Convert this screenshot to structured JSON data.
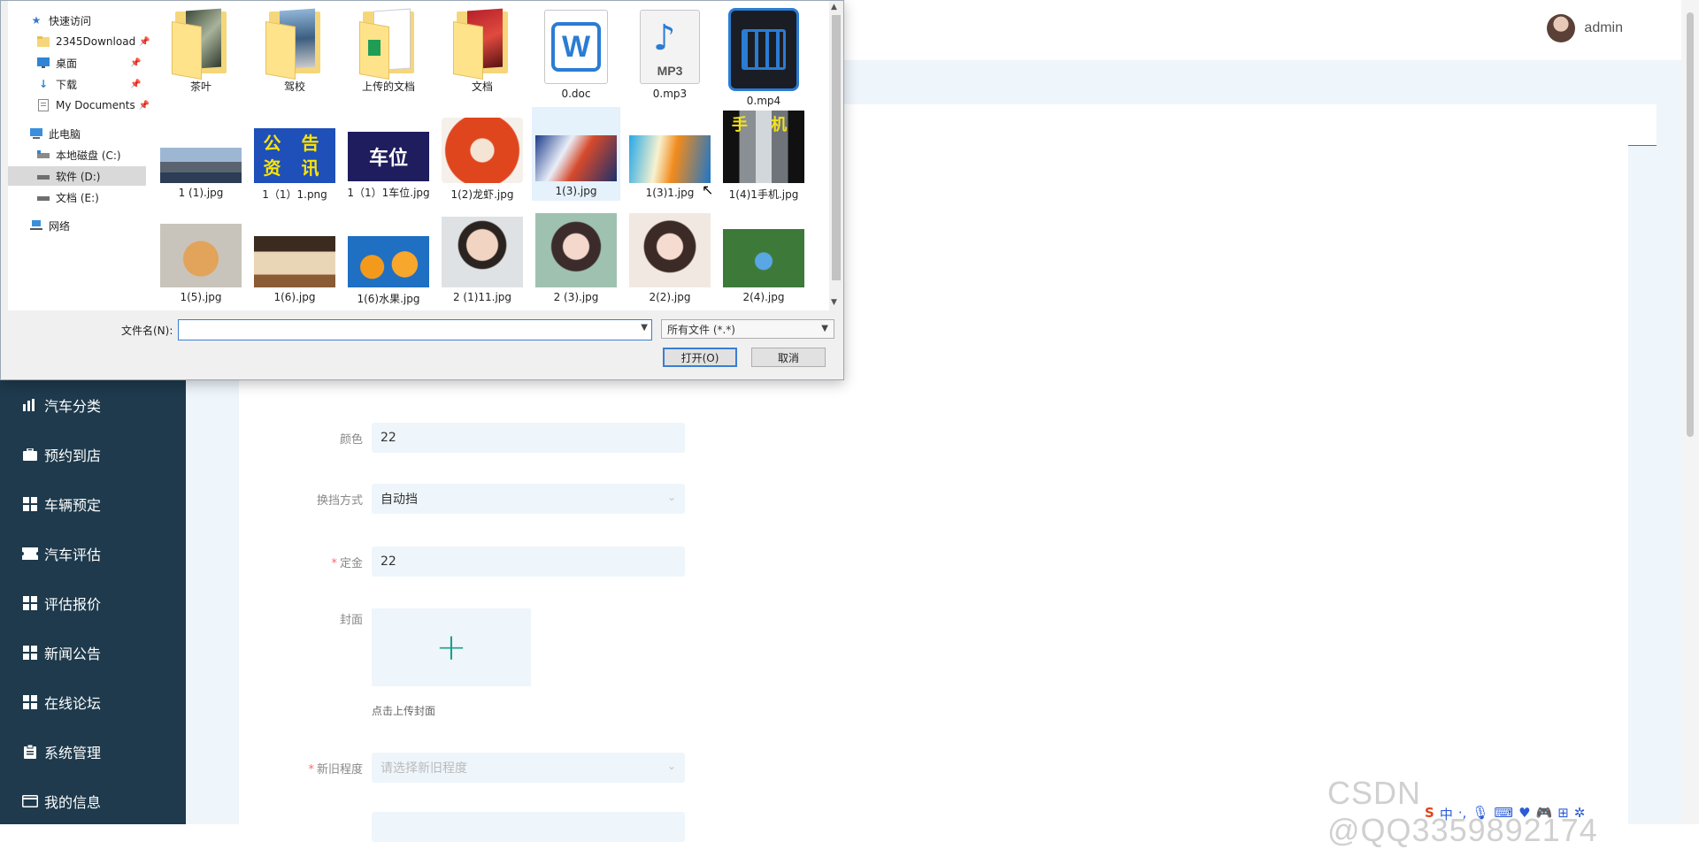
{
  "user": {
    "name": "admin"
  },
  "sidebar": {
    "items": [
      {
        "label": "汽车分类",
        "icon": "bar-chart-icon"
      },
      {
        "label": "预约到店",
        "icon": "briefcase-icon"
      },
      {
        "label": "车辆预定",
        "icon": "grid-icon"
      },
      {
        "label": "汽车评估",
        "icon": "ticket-icon"
      },
      {
        "label": "评估报价",
        "icon": "grid-icon"
      },
      {
        "label": "新闻公告",
        "icon": "grid-icon"
      },
      {
        "label": "在线论坛",
        "icon": "grid-icon"
      },
      {
        "label": "系统管理",
        "icon": "clipboard-icon"
      },
      {
        "label": "我的信息",
        "icon": "id-card-icon"
      }
    ]
  },
  "form": {
    "color_label": "颜色",
    "color_value": "22",
    "gear_label": "换挡方式",
    "gear_value": "自动挡",
    "deposit_label": "定金",
    "deposit_value": "22",
    "cover_label": "封面",
    "cover_hint": "点击上传封面",
    "condition_label": "新旧程度",
    "condition_placeholder": "请选择新旧程度"
  },
  "dialog": {
    "nav": [
      {
        "label": "快速访问",
        "icon": "star-icon"
      },
      {
        "label": "2345Download",
        "icon": "folder-icon",
        "pinned": true
      },
      {
        "label": "桌面",
        "icon": "desktop-icon",
        "pinned": true
      },
      {
        "label": "下载",
        "icon": "download-icon",
        "pinned": true
      },
      {
        "label": "My Documents",
        "icon": "document-icon",
        "pinned": true
      },
      {
        "label": "此电脑",
        "icon": "computer-icon"
      },
      {
        "label": "本地磁盘 (C:)",
        "icon": "drive-icon"
      },
      {
        "label": "软件 (D:)",
        "icon": "drive-icon"
      },
      {
        "label": "文档 (E:)",
        "icon": "drive-icon"
      },
      {
        "label": "网络",
        "icon": "network-icon"
      }
    ],
    "files": [
      {
        "name": "茶叶",
        "kind": "folder"
      },
      {
        "name": "驾校",
        "kind": "folder"
      },
      {
        "name": "上传的文档",
        "kind": "folder"
      },
      {
        "name": "文档",
        "kind": "folder"
      },
      {
        "name": "0.doc",
        "kind": "doc"
      },
      {
        "name": "0.mp3",
        "kind": "mp3",
        "badge": "MP3"
      },
      {
        "name": "0.mp4",
        "kind": "mp4"
      },
      {
        "name": "1 (1).jpg",
        "kind": "image"
      },
      {
        "name": "1（1）1.png",
        "kind": "image",
        "text": "公 告 资 讯"
      },
      {
        "name": "1（1）1车位.jpg",
        "kind": "image",
        "text": "车位"
      },
      {
        "name": "1(2)龙虾.jpg",
        "kind": "image"
      },
      {
        "name": "1(3).jpg",
        "kind": "image"
      },
      {
        "name": "1(3)1.jpg",
        "kind": "image"
      },
      {
        "name": "1(4)1手机.jpg",
        "kind": "image",
        "text": "手 机"
      },
      {
        "name": "1(5).jpg",
        "kind": "image"
      },
      {
        "name": "1(6).jpg",
        "kind": "image"
      },
      {
        "name": "1(6)水果.jpg",
        "kind": "image"
      },
      {
        "name": "2 (1)11.jpg",
        "kind": "image"
      },
      {
        "name": "2 (3).jpg",
        "kind": "image"
      },
      {
        "name": "2(2).jpg",
        "kind": "image"
      },
      {
        "name": "2(4).jpg",
        "kind": "image"
      }
    ],
    "filename_label": "文件名(N):",
    "filename_value": "",
    "filter_value": "所有文件 (*.*)",
    "open_label": "打开(O)",
    "cancel_label": "取消"
  },
  "watermark": "CSDN @QQ3359892174",
  "ime": {
    "s": "S",
    "lang": "中"
  },
  "colors": {
    "sidebar": "#1e3a4c",
    "content_bg": "#eef5fb",
    "accent": "#1aa08a",
    "required": "#f56c6c"
  }
}
